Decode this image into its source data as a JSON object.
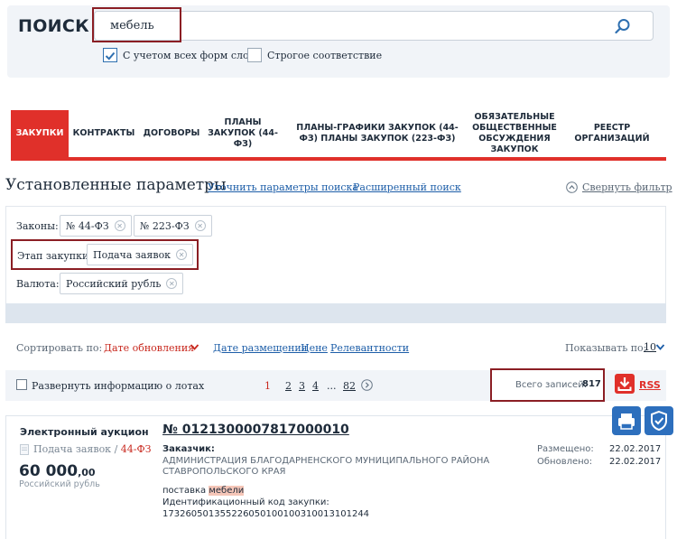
{
  "search": {
    "title": "ПОИСК",
    "query": "мебель",
    "morph_label": "С учетом всех форм слов",
    "strict_label": "Строгое соответствие"
  },
  "tabs": [
    {
      "label": "ЗАКУПКИ",
      "active": true
    },
    {
      "label": "КОНТРАКТЫ"
    },
    {
      "label": "ДОГОВОРЫ"
    },
    {
      "label": "ПЛАНЫ ЗАКУПОК (44-ФЗ)"
    },
    {
      "label": "ПЛАНЫ-ГРАФИКИ ЗАКУПОК (44-ФЗ) ПЛАНЫ ЗАКУПОК (223-ФЗ)"
    },
    {
      "label": "ОБЯЗАТЕЛЬНЫЕ ОБЩЕСТВЕННЫЕ ОБСУЖДЕНИЯ ЗАКУПОК"
    },
    {
      "label": "РЕЕСТР ОРГАНИЗАЦИЙ"
    }
  ],
  "filter": {
    "title": "Установленные параметры",
    "refine_link": "Уточнить параметры поиска",
    "advanced_link": "Расширенный поиск",
    "collapse_link": "Свернуть фильтр",
    "laws_label": "Законы:",
    "law_chip_1": "№ 44-ФЗ",
    "law_chip_2": "№ 223-ФЗ",
    "stage_label": "Этап закупки:",
    "stage_chip": "Подача заявок",
    "currency_label": "Валюта:",
    "currency_chip": "Российский рубль"
  },
  "sort": {
    "label": "Сортировать по:",
    "active": "Дате обновления",
    "opt_placed": "Дате размещения",
    "opt_price": "Цене",
    "opt_relevance": "Релевантности",
    "show_label": "Показывать по:",
    "show_value": "10"
  },
  "list": {
    "expand_label": "Развернуть информацию о лотах",
    "pages": [
      "1",
      "2",
      "3",
      "4",
      "...",
      "82"
    ],
    "total_label": "Всего записей:",
    "total_value": "817",
    "rss_label": "RSS"
  },
  "card": {
    "type": "Электронный аукцион",
    "stage": "Подача заявок",
    "stage_sep": "/",
    "law": "44-ФЗ",
    "price_main": "60 000",
    "price_frac": ",00",
    "currency": "Российский рубль",
    "number": "№ 0121300007817000010",
    "customer_label": "Заказчик:",
    "customer_line1": "АДМИНИСТРАЦИЯ БЛАГОДАРНЕНСКОГО МУНИЦИПАЛЬНОГО РАЙОНА",
    "customer_line2": "СТАВРОПОЛЬСКОГО КРАЯ",
    "subject_prefix": "поставка",
    "subject_highlight": "мебели",
    "id_label": "Идентификационный код закупки:",
    "id_value": "173260501355226050100100310013101244",
    "placed_label": "Размещено:",
    "placed_value": "22.02.2017",
    "updated_label": "Обновлено:",
    "updated_value": "22.02.2017"
  },
  "colors": {
    "accent_red": "#e0302a",
    "highlight_border": "#8b1e24",
    "link_blue": "#1d5ea8",
    "fab_blue": "#2d6fbd"
  }
}
